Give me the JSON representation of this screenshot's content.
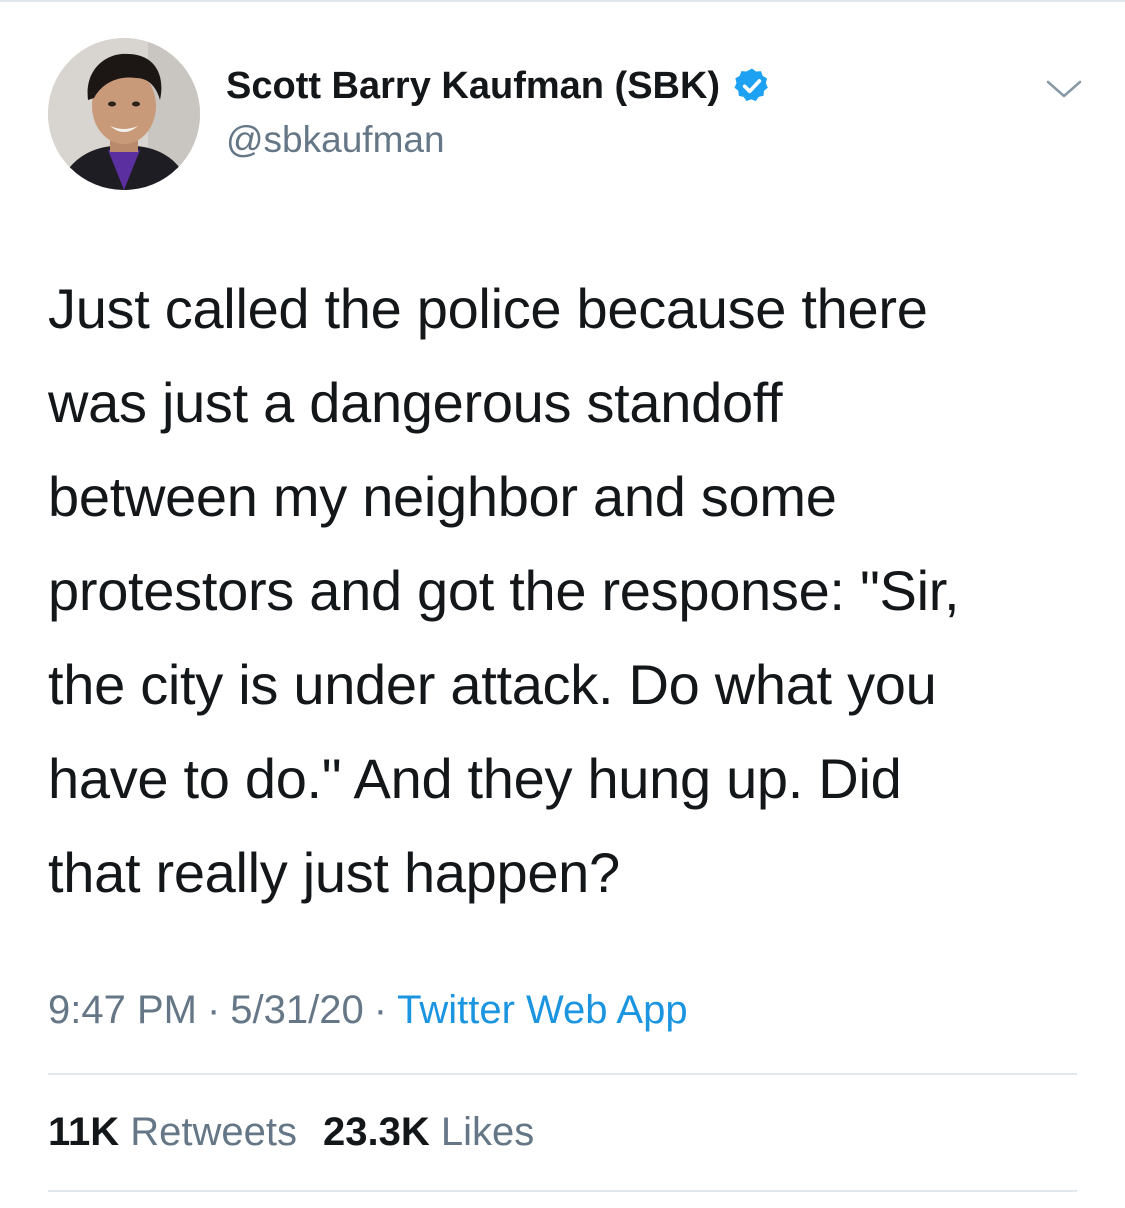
{
  "author": {
    "name": "Scott Barry Kaufman (SBK)",
    "handle": "@sbkaufman",
    "verified": true,
    "avatar_icon": "profile-photo"
  },
  "menu_icon": "chevron-down-icon",
  "tweet": {
    "text": "Just called the police because there\nwas just a dangerous standoff\nbetween my neighbor and some\nprotestors and got the response: \"Sir,\nthe city is under attack. Do what you\nhave to do.\" And they hung up. Did\nthat really just happen?",
    "time": "9:47 PM",
    "separator": "·",
    "date": "5/31/20",
    "source": "Twitter Web App"
  },
  "stats": {
    "retweets_count": "11K",
    "retweets_label": "Retweets",
    "likes_count": "23.3K",
    "likes_label": "Likes"
  },
  "colors": {
    "text": "#14171a",
    "secondary": "#657786",
    "link": "#1b95e0",
    "verified": "#1da1f2",
    "divider": "#e1e8ed"
  }
}
